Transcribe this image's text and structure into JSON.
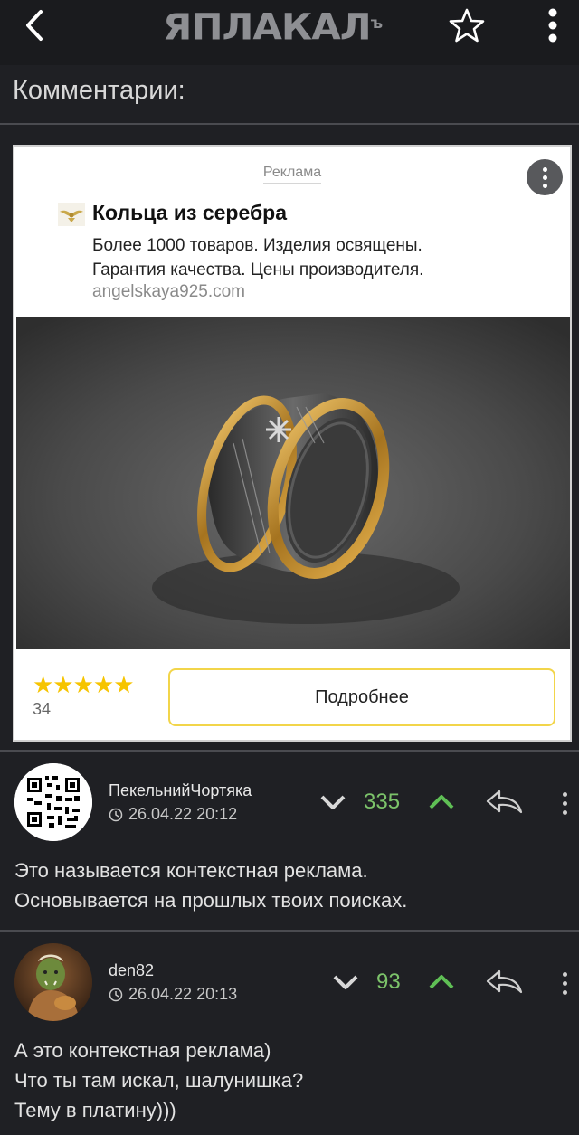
{
  "header": {
    "logo_text": "ЯПЛАКАЛ",
    "logo_suffix": "ъ"
  },
  "section": {
    "title": "Комментарии:"
  },
  "ad": {
    "label": "Реклама",
    "title": "Кольца из серебра",
    "description_lines": [
      "Более 1000 товаров. Изделия освящены.",
      "Гарантия качества. Цены производителя."
    ],
    "url": "angelskaya925.com",
    "stars": "★★★★★",
    "rating_count": "34",
    "cta_label": "Подробнее",
    "star_color": "#f6c400"
  },
  "comments": [
    {
      "author": "ПекельнийЧортяка",
      "date": "26.04.22 20:12",
      "score": "335",
      "text_lines": [
        "Это называется контекстная реклама.",
        "Основывается на прошлых твоих поисках."
      ]
    },
    {
      "author": "den82",
      "date": "26.04.22 20:13",
      "score": "93",
      "text_lines": [
        "А это контекстная реклама)",
        "Что ты там искал, шалунишка?",
        "Тему в платину)))"
      ]
    }
  ],
  "colors": {
    "background": "#1f2024",
    "score_green": "#7cc36a",
    "accent_yellow": "#f2d54a"
  }
}
